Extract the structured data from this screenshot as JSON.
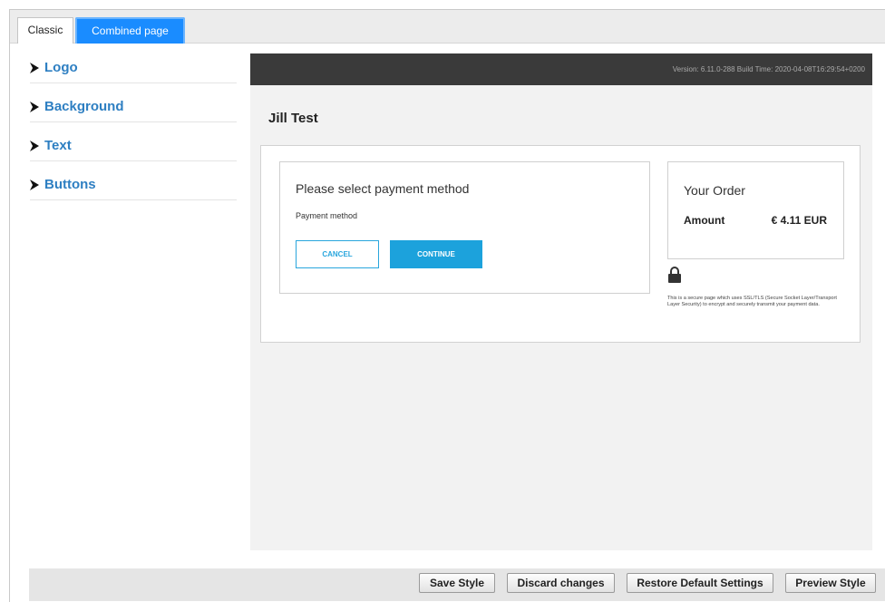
{
  "tabs": {
    "classic": "Classic",
    "combined": "Combined page"
  },
  "sidebar": {
    "items": [
      {
        "label": "Logo"
      },
      {
        "label": "Background"
      },
      {
        "label": "Text"
      },
      {
        "label": "Buttons"
      }
    ]
  },
  "preview": {
    "version_text": "Version: 6.11.0-288 Build Time: 2020-04-08T16:29:54+0200",
    "merchant_name": "Jill Test",
    "payment": {
      "title": "Please select payment method",
      "method_label": "Payment method",
      "cancel_label": "CANCEL",
      "continue_label": "CONTINUE"
    },
    "order": {
      "title": "Your Order",
      "amount_label": "Amount",
      "amount_value": "€ 4.11 EUR"
    },
    "secure_text": "This is a secure page which uses SSL/TLS (Secure Socket Layer/Transport Layer Security) to encrypt and securely transmit your payment data."
  },
  "footer": {
    "save": "Save Style",
    "discard": "Discard changes",
    "restore": "Restore Default Settings",
    "preview": "Preview Style"
  },
  "colors": {
    "accent_blue": "#1a8cff",
    "button_blue": "#1ca2dc",
    "sidebar_link": "#2e7fc2",
    "header_dark": "#3a3a3a"
  },
  "icons": {
    "accordion": "triangle-right-icon",
    "lock": "lock-icon"
  }
}
